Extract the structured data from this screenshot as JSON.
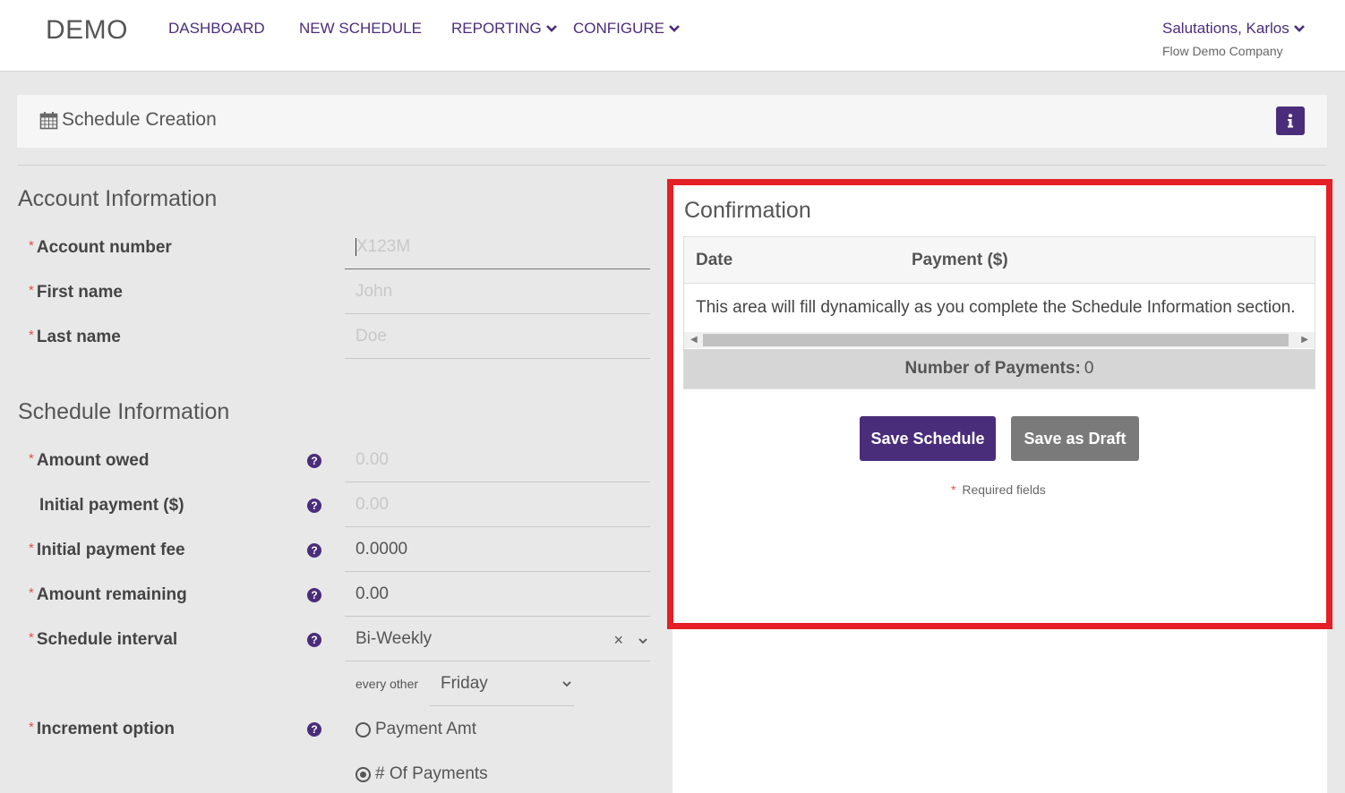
{
  "nav": {
    "brand": "DEMO",
    "items": [
      {
        "label": "DASHBOARD",
        "dropdown": false
      },
      {
        "label": "NEW SCHEDULE",
        "dropdown": false
      },
      {
        "label": "REPORTING",
        "dropdown": true
      },
      {
        "label": "CONFIGURE",
        "dropdown": true
      }
    ],
    "user": "Salutations, Karlos",
    "company": "Flow Demo Company"
  },
  "page": {
    "title": "Schedule Creation",
    "info_icon": "info-icon"
  },
  "account": {
    "section_title": "Account Information",
    "fields": {
      "account_number": {
        "label": "Account number",
        "placeholder": "X123M"
      },
      "first_name": {
        "label": "First name",
        "placeholder": "John"
      },
      "last_name": {
        "label": "Last name",
        "placeholder": "Doe"
      }
    }
  },
  "schedule": {
    "section_title": "Schedule Information",
    "fields": {
      "amount_owed": {
        "label": "Amount owed",
        "placeholder": "0.00"
      },
      "initial_payment": {
        "label": "Initial payment ($)",
        "placeholder": "0.00"
      },
      "initial_fee": {
        "label": "Initial payment fee",
        "value": "0.0000"
      },
      "amount_remaining": {
        "label": "Amount remaining",
        "value": "0.00"
      },
      "interval": {
        "label": "Schedule interval",
        "value": "Bi-Weekly"
      },
      "every_other": {
        "label": "every other",
        "value": "Friday"
      },
      "increment": {
        "label": "Increment option",
        "options": [
          "Payment Amt",
          "# Of Payments"
        ],
        "selected": "# Of Payments"
      }
    }
  },
  "confirmation": {
    "title": "Confirmation",
    "columns": [
      "Date",
      "Payment ($)"
    ],
    "empty_message": "This area will fill dynamically as you complete the Schedule Information section.",
    "count_label": "Number of Payments:",
    "count_value": "0",
    "save_label": "Save Schedule",
    "draft_label": "Save as Draft",
    "required_note": "Required fields"
  },
  "colors": {
    "brand": "#4a2d7a",
    "highlight": "#e61e25",
    "required": "#d9534f"
  }
}
